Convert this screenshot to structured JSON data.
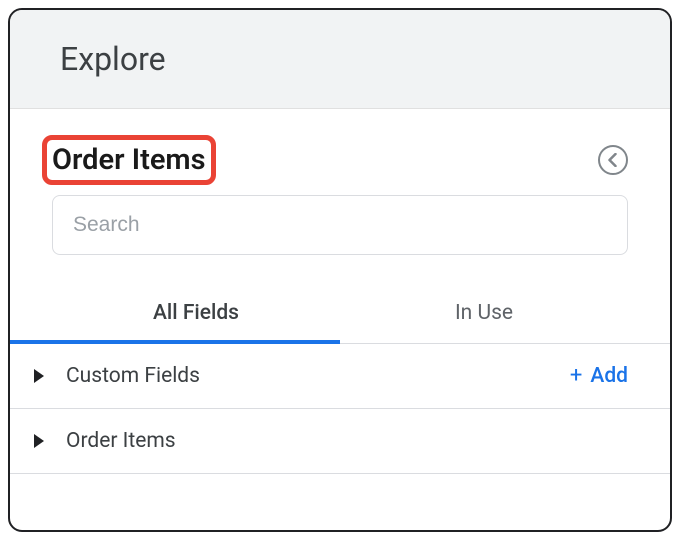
{
  "header": {
    "title": "Explore"
  },
  "panel": {
    "title": "Order Items",
    "search_placeholder": "Search"
  },
  "tabs": {
    "all_fields": "All Fields",
    "in_use": "In Use"
  },
  "sections": {
    "custom_fields": {
      "label": "Custom Fields",
      "add_label": "Add"
    },
    "order_items": {
      "label": "Order Items"
    }
  },
  "colors": {
    "accent": "#1a73e8",
    "highlight": "#ea4335"
  }
}
